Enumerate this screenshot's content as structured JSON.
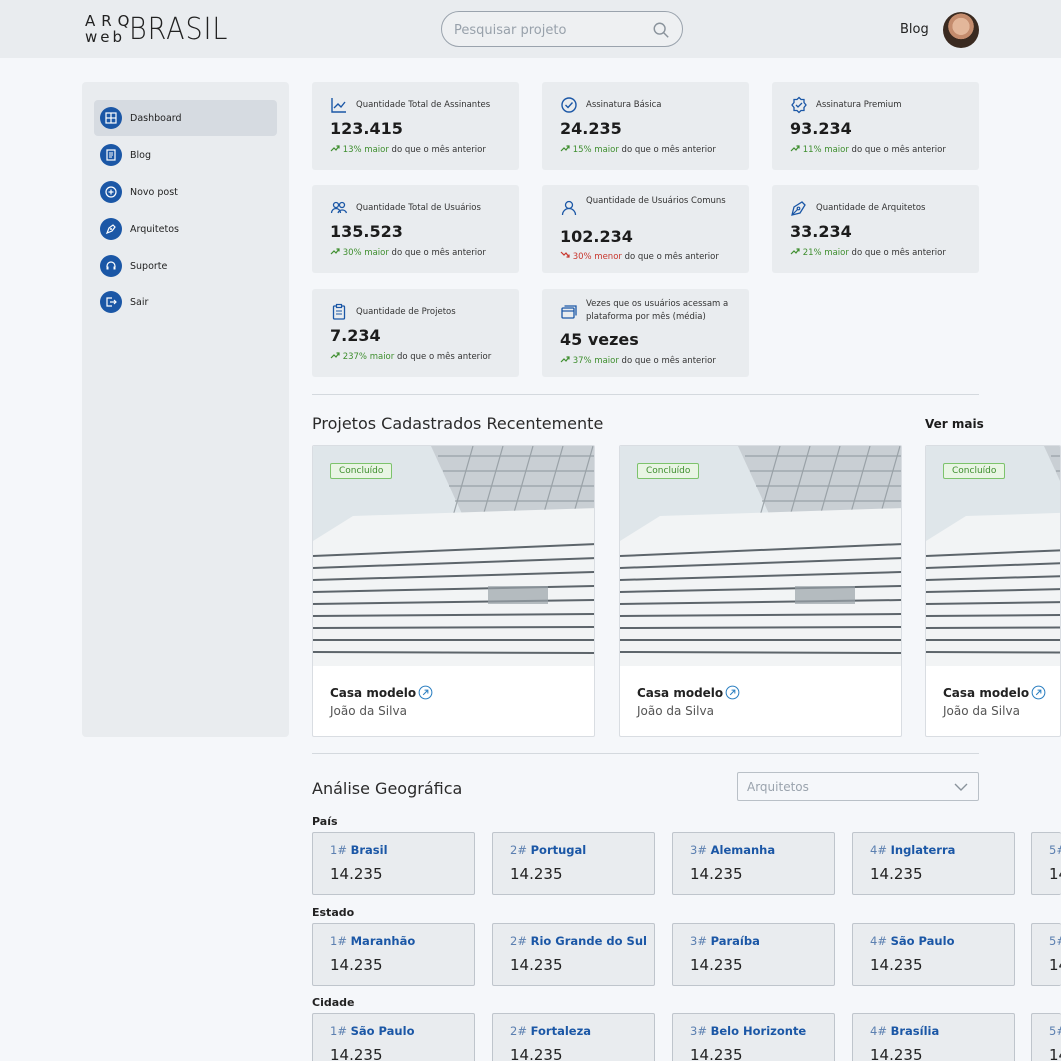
{
  "header": {
    "logo": {
      "arq": "ARQ",
      "web": "web",
      "brasil": "BRASIL"
    },
    "search_placeholder": "Pesquisar projeto",
    "blog_label": "Blog"
  },
  "sidebar": {
    "items": [
      {
        "label": "Dashboard",
        "icon": "dashboard-icon",
        "active": true
      },
      {
        "label": "Blog",
        "icon": "document-icon"
      },
      {
        "label": "Novo post",
        "icon": "plus-circle-icon"
      },
      {
        "label": "Arquitetos",
        "icon": "pen-tool-icon"
      },
      {
        "label": "Suporte",
        "icon": "headset-icon"
      },
      {
        "label": "Sair",
        "icon": "logout-icon"
      }
    ]
  },
  "stats": [
    {
      "title": "Quantidade Total de Assinantes",
      "value": "123.415",
      "pct": "13% maior",
      "rest": " do que o mês anterior",
      "dir": "up"
    },
    {
      "title": "Assinatura Básica",
      "value": "24.235",
      "pct": "15% maior",
      "rest": " do que o mês anterior",
      "dir": "up"
    },
    {
      "title": "Assinatura Premium",
      "value": "93.234",
      "pct": "11% maior",
      "rest": " do que o mês anterior",
      "dir": "up"
    },
    {
      "title": "Quantidade Total de Usuários",
      "value": "135.523",
      "pct": "30% maior",
      "rest": " do que o mês anterior",
      "dir": "up"
    },
    {
      "title": "Quantidade de Usuários Comuns",
      "value": "102.234",
      "pct": "30% menor",
      "rest": " do que o mês anterior",
      "dir": "down"
    },
    {
      "title": "Quantidade de Arquitetos",
      "value": "33.234",
      "pct": "21% maior",
      "rest": " do que o mês anterior",
      "dir": "up"
    },
    {
      "title": "Quantidade de Projetos",
      "value": "7.234",
      "pct": "237% maior",
      "rest": " do que o mês anterior",
      "dir": "up"
    },
    {
      "title": "Vezes que os usuários acessam a plataforma por mês (média)",
      "value": "45 vezes",
      "pct": "37% maior",
      "rest": " do que o mês anterior",
      "dir": "up"
    }
  ],
  "projects": {
    "section_title": "Projetos Cadastrados Recentemente",
    "see_more": "Ver mais",
    "items": [
      {
        "status": "Concluído",
        "title": "Casa modelo",
        "author": "João da Silva"
      },
      {
        "status": "Concluído",
        "title": "Casa modelo",
        "author": "João da Silva"
      },
      {
        "status": "Concluído",
        "title": "Casa modelo",
        "author": "João da Silva"
      }
    ]
  },
  "geo": {
    "section_title": "Análise Geográfica",
    "filter_value": "Arquitetos",
    "groups": [
      {
        "label": "País",
        "items": [
          {
            "rank": "1#",
            "name": "Brasil",
            "value": "14.235"
          },
          {
            "rank": "2#",
            "name": "Portugal",
            "value": "14.235"
          },
          {
            "rank": "3#",
            "name": "Alemanha",
            "value": "14.235"
          },
          {
            "rank": "4#",
            "name": "Inglaterra",
            "value": "14.235"
          },
          {
            "rank": "5#",
            "name": "",
            "value": "14"
          }
        ]
      },
      {
        "label": "Estado",
        "items": [
          {
            "rank": "1#",
            "name": "Maranhão",
            "value": "14.235"
          },
          {
            "rank": "2#",
            "name": "Rio Grande do Sul",
            "value": "14.235"
          },
          {
            "rank": "3#",
            "name": "Paraíba",
            "value": "14.235"
          },
          {
            "rank": "4#",
            "name": "São Paulo",
            "value": "14.235"
          },
          {
            "rank": "5#",
            "name": "",
            "value": "14"
          }
        ]
      },
      {
        "label": "Cidade",
        "items": [
          {
            "rank": "1#",
            "name": "São Paulo",
            "value": "14.235"
          },
          {
            "rank": "2#",
            "name": "Fortaleza",
            "value": "14.235"
          },
          {
            "rank": "3#",
            "name": "Belo Horizonte",
            "value": "14.235"
          },
          {
            "rank": "4#",
            "name": "Brasília",
            "value": "14.235"
          },
          {
            "rank": "5#",
            "name": "",
            "value": "14"
          }
        ]
      }
    ]
  },
  "colors": {
    "brand": "#1b57a6",
    "up": "#3e8e2e",
    "down": "#c8362d"
  }
}
